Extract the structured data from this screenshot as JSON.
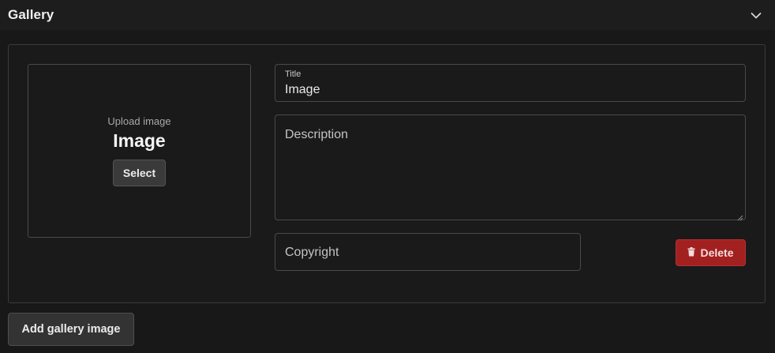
{
  "header": {
    "title": "Gallery",
    "toggle_icon": "chevron-down-icon"
  },
  "gallery_item": {
    "upload": {
      "hint": "Upload image",
      "title": "Image",
      "select_label": "Select"
    },
    "title_field": {
      "label": "Title",
      "value": "Image"
    },
    "description_field": {
      "placeholder": "Description"
    },
    "copyright_field": {
      "placeholder": "Copyright"
    },
    "delete_label": "Delete",
    "delete_icon": "trash-icon"
  },
  "add_button_label": "Add gallery image",
  "colors": {
    "background": "#181818",
    "delete": "#a32020",
    "button": "#333333"
  }
}
